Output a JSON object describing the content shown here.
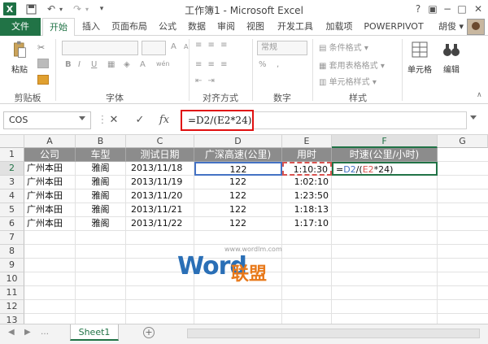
{
  "window": {
    "title": "工作簿1 - Microsoft Excel",
    "logo": "X",
    "help": "?",
    "restore": "▣",
    "minimize": "−",
    "maximize": "□",
    "close": "✕"
  },
  "qat": {
    "save_icon": "save-icon",
    "undo_icon": "undo-icon",
    "redo_icon": "redo-icon"
  },
  "tabs": [
    "文件",
    "开始",
    "插入",
    "页面布局",
    "公式",
    "数据",
    "审阅",
    "视图",
    "开发工具",
    "加载项",
    "POWERPIVOT"
  ],
  "user": "胡俊 ▾",
  "ribbon": {
    "clipboard": {
      "paste": "粘贴",
      "label": "剪贴板"
    },
    "font": {
      "label": "字体",
      "bold": "B",
      "italic": "I",
      "underline": "U",
      "size_a": "A",
      "wen": "wén"
    },
    "alignment": {
      "label": "对齐方式"
    },
    "number": {
      "label": "数字",
      "format": "常规",
      "percent": "%",
      "comma": ","
    },
    "styles": {
      "label": "样式",
      "cond_format": "条件格式 ▾",
      "table_format": "套用表格格式 ▾",
      "cell_styles": "单元格样式 ▾"
    },
    "cells": {
      "label": "单元格"
    },
    "editing": {
      "label": "编辑"
    }
  },
  "formula_bar": {
    "name_box": "COS",
    "cancel": "✕",
    "enter": "✓",
    "fx": "fx",
    "formula": "=D2/(E2*24)"
  },
  "columns": [
    "A",
    "B",
    "C",
    "D",
    "E",
    "F",
    "G"
  ],
  "rows": [
    "1",
    "2",
    "3",
    "4",
    "5",
    "6",
    "7",
    "8",
    "9",
    "10",
    "11",
    "12",
    "13"
  ],
  "table": {
    "headers": [
      "公司",
      "车型",
      "测试日期",
      "广深高速(公里)",
      "用时",
      "时速(公里/小时)"
    ],
    "rows": [
      [
        "广州本田",
        "雅阁",
        "2013/11/18",
        "122",
        "1:10:30"
      ],
      [
        "广州本田",
        "雅阁",
        "2013/11/19",
        "122",
        "1:02:10"
      ],
      [
        "广州本田",
        "雅阁",
        "2013/11/20",
        "122",
        "1:23:50"
      ],
      [
        "广州本田",
        "雅阁",
        "2013/11/21",
        "122",
        "1:18:13"
      ],
      [
        "广州本田",
        "雅阁",
        "2013/11/22",
        "122",
        "1:17:10"
      ]
    ],
    "edit_cell": {
      "eq": "=",
      "d2": "D2",
      "open": "/(",
      "e2": "E2",
      "rest": "*24)"
    }
  },
  "sheet_tabs": [
    "Sheet1"
  ],
  "watermark": {
    "url": "www.wordlm.com",
    "word": "Word",
    "cn": "联盟"
  },
  "colors": {
    "accent": "#217346",
    "header_fill": "#8c8c8c",
    "ref_blue": "#4472c4",
    "ref_red": "#d9534f",
    "highlight": "#e01010"
  }
}
